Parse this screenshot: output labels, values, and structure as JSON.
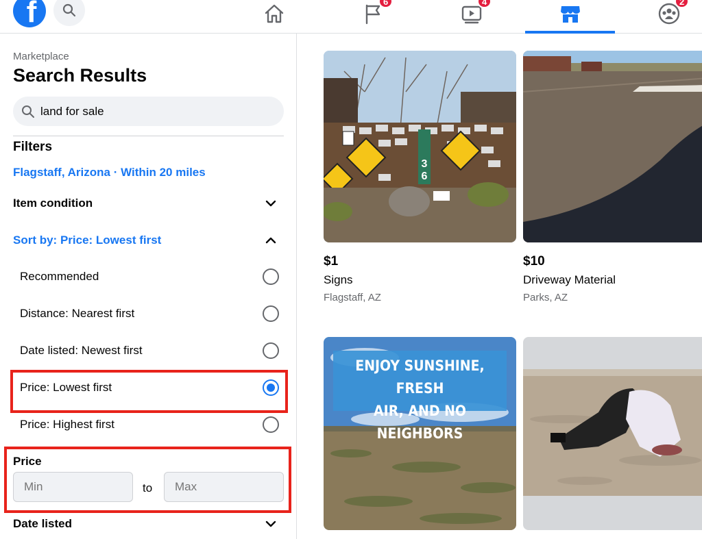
{
  "nav": {
    "logo_letter": "f",
    "badges": {
      "pages": "6",
      "watch": "4",
      "groups": "2"
    }
  },
  "sidebar": {
    "breadcrumb": "Marketplace",
    "title": "Search Results",
    "search_value": "land for sale",
    "filters_heading": "Filters",
    "location": "Flagstaff, Arizona · Within 20 miles",
    "item_condition": "Item condition",
    "sort_by": "Sort by: Price: Lowest first",
    "sort_options": [
      {
        "label": "Recommended",
        "selected": false
      },
      {
        "label": "Distance: Nearest first",
        "selected": false
      },
      {
        "label": "Date listed: Newest first",
        "selected": false
      },
      {
        "label": "Price: Lowest first",
        "selected": true
      },
      {
        "label": "Price: Highest first",
        "selected": false
      }
    ],
    "price_label": "Price",
    "min_placeholder": "Min",
    "to_label": "to",
    "max_placeholder": "Max",
    "date_listed": "Date listed"
  },
  "listings": [
    {
      "price": "$1",
      "title": "Signs",
      "location": "Flagstaff, AZ"
    },
    {
      "price": "$10",
      "title": "Driveway Material",
      "location": "Parks, AZ"
    },
    {
      "banner_line1": "ENJOY SUNSHINE, FRESH",
      "banner_line2": "AIR, AND NO NEIGHBORS"
    },
    {}
  ],
  "colors": {
    "accent": "#1877f2",
    "highlight": "#e8231b",
    "badge": "#e41e3f"
  }
}
